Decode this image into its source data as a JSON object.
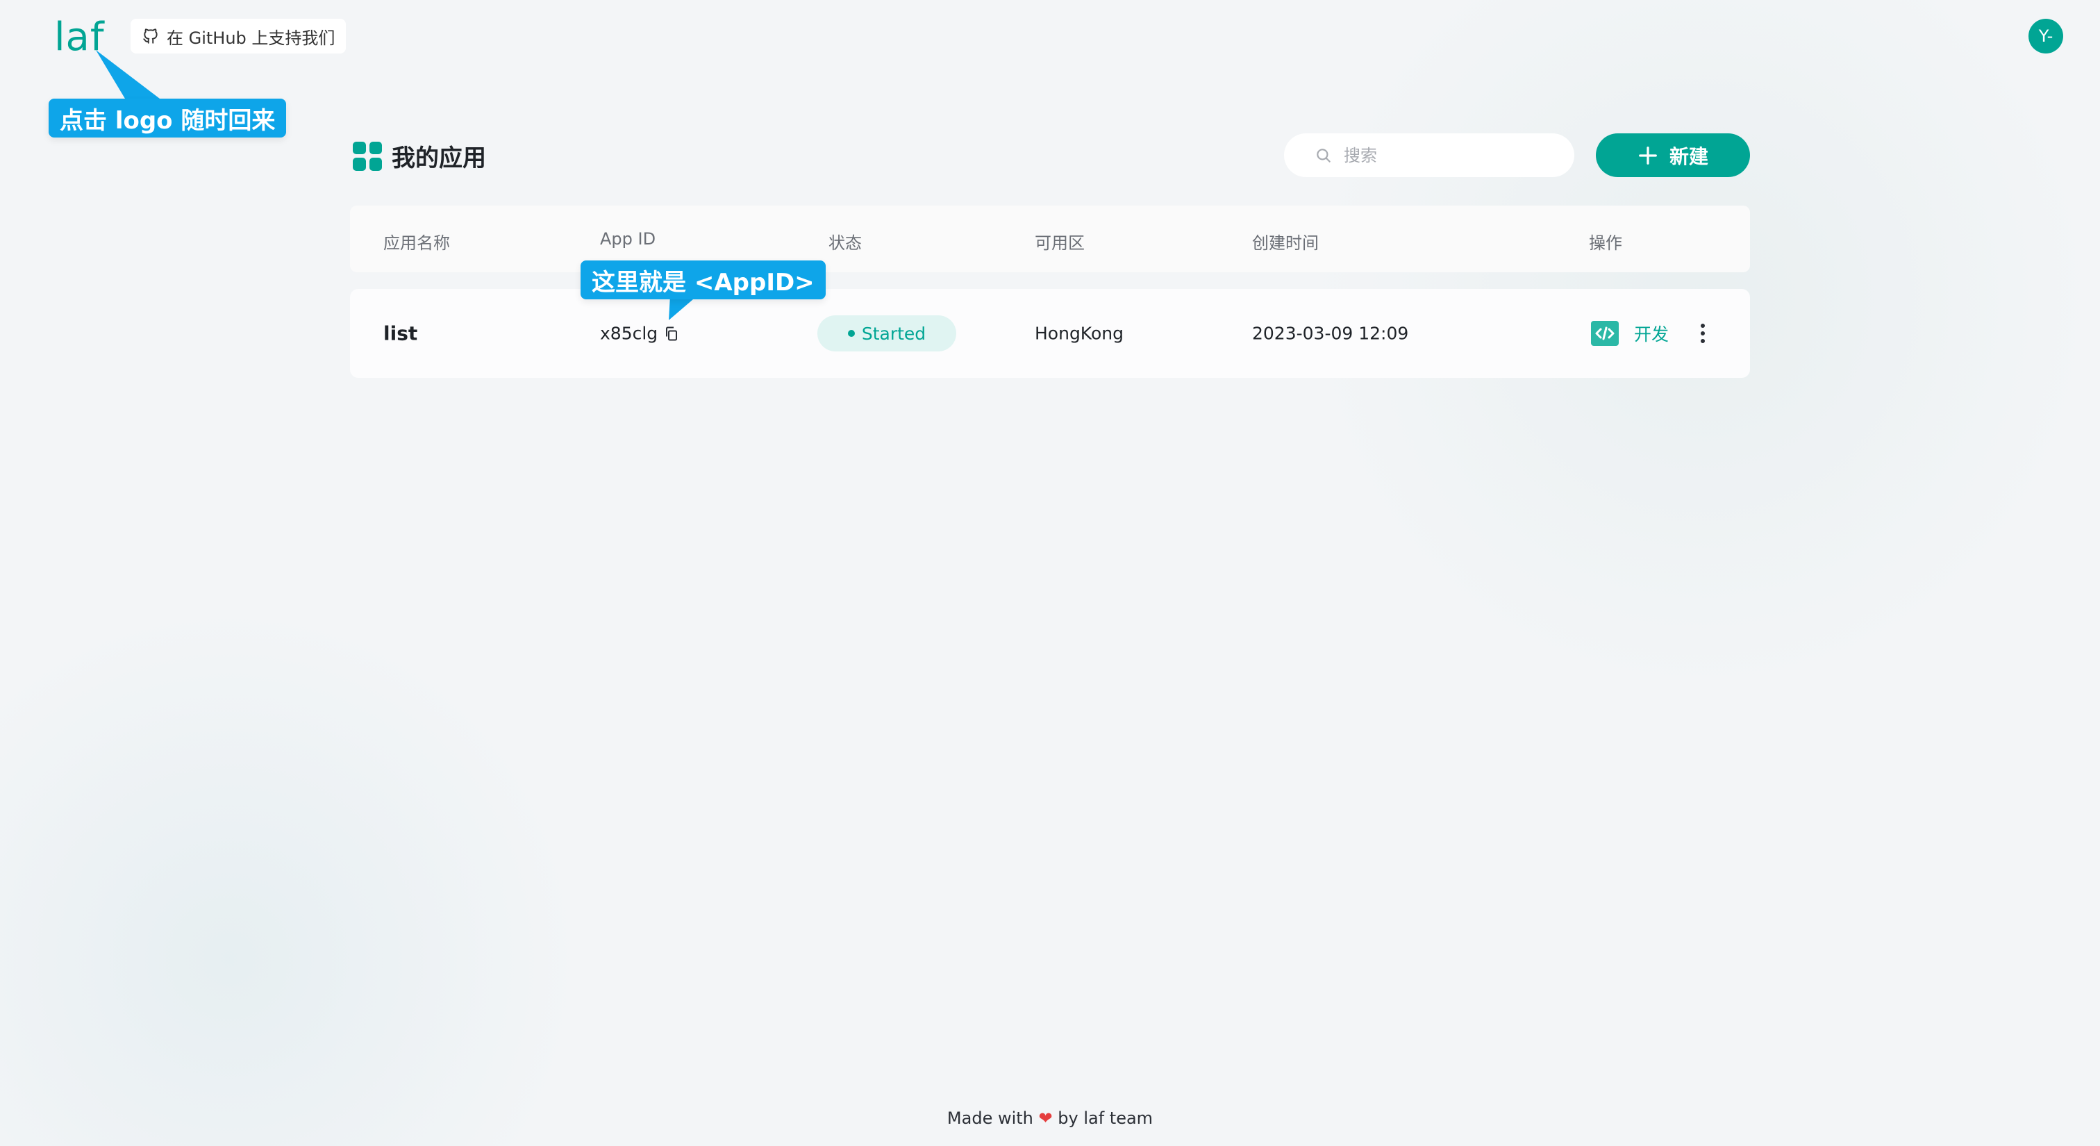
{
  "header": {
    "logo_text": "laf",
    "github_label": "在 GitHub 上支持我们",
    "avatar_text": "Y-"
  },
  "callouts": {
    "logo_hint": "点击 logo 随时回来",
    "appid_hint": "这里就是 <AppID>"
  },
  "main": {
    "title": "我的应用",
    "search_placeholder": "搜索",
    "new_button_label": "新建",
    "table": {
      "columns": [
        "应用名称",
        "App ID",
        "状态",
        "可用区",
        "创建时间",
        "操作"
      ],
      "rows": [
        {
          "name": "list",
          "app_id": "x85clg",
          "status": "Started",
          "region": "HongKong",
          "created_at": "2023-03-09 12:09",
          "action_label": "开发"
        }
      ]
    }
  },
  "footer": {
    "prefix": "Made with",
    "suffix": "by laf team"
  },
  "colors": {
    "accent": "#01a594",
    "callout": "#0ea5e9",
    "background": "#f3f5f7"
  }
}
